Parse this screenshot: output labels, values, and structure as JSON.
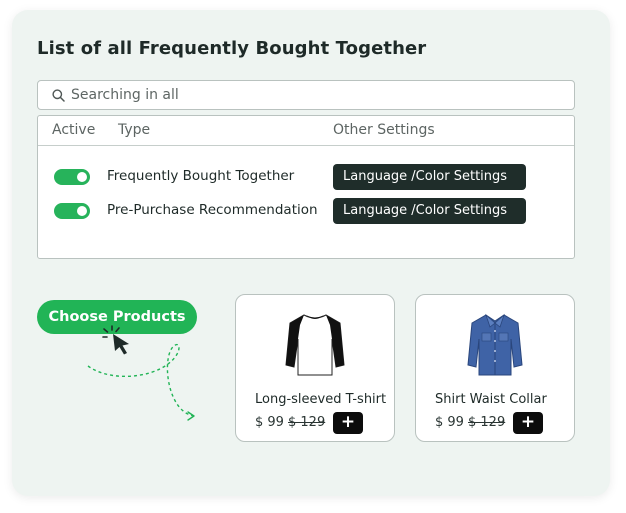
{
  "title": "List of all Frequently Bought Together",
  "search": {
    "placeholder": "Searching in all",
    "icon": "search-icon"
  },
  "table": {
    "headers": {
      "active": "Active",
      "type": "Type",
      "settings": "Other Settings"
    },
    "rows": [
      {
        "active": true,
        "type": "Frequently Bought Together",
        "settings_label": "Language /Color Settings"
      },
      {
        "active": true,
        "type": "Pre-Purchase Recommendation",
        "settings_label": "Language /Color Settings"
      }
    ]
  },
  "choose_button": "Choose Products",
  "products": [
    {
      "name": "Long-sleeved T-shirt",
      "price": "$ 99",
      "old_price": "$ 129",
      "add_label": "+",
      "image_icon": "raglan-shirt-icon"
    },
    {
      "name": "Shirt Waist Collar",
      "price": "$ 99",
      "old_price": "$ 129",
      "add_label": "+",
      "image_icon": "denim-shirt-icon"
    }
  ],
  "colors": {
    "accent": "#21b456",
    "dark_button": "#1f2d2a",
    "card_bg": "#eef4f1"
  }
}
